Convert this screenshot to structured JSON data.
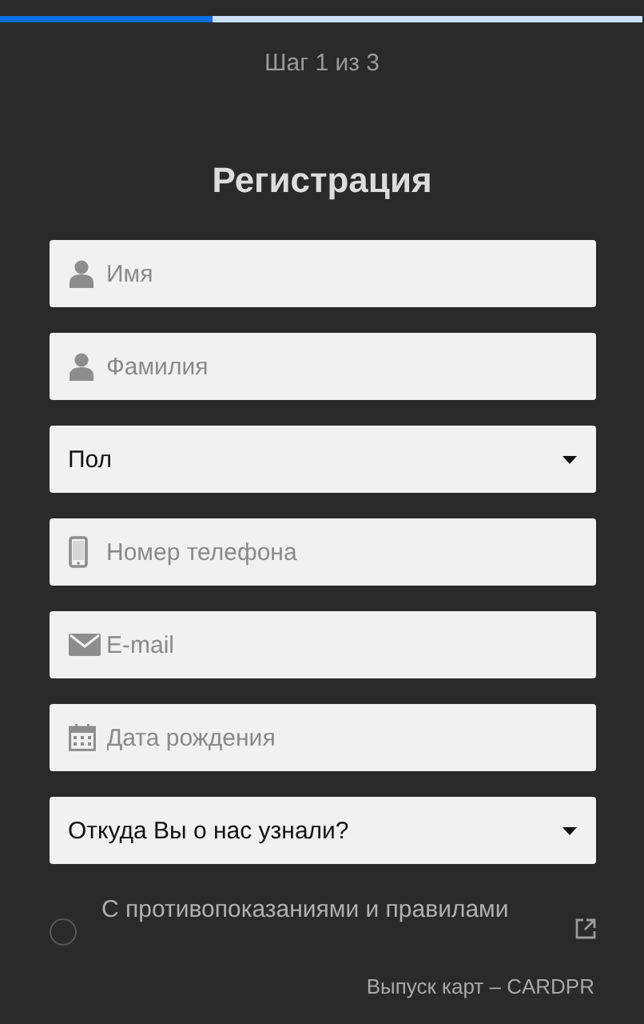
{
  "progress": {
    "level": 0.33
  },
  "step": "Шаг 1 из 3",
  "title": "Регистрация",
  "fields": [
    {
      "kind": "person",
      "placeholder": "Имя"
    },
    {
      "kind": "person",
      "placeholder": "Фамилия"
    },
    {
      "kind": "select",
      "value": "Пол"
    },
    {
      "kind": "phone",
      "placeholder": "Номер телефона"
    },
    {
      "kind": "mail",
      "placeholder": "E-mail"
    },
    {
      "kind": "calendar",
      "placeholder": "Дата рождения"
    },
    {
      "kind": "select",
      "value": "Откуда Вы о нас узнали?"
    }
  ],
  "agreement": {
    "checked": false,
    "text": "С противопоказаниями и правилами"
  },
  "footer": "Выпуск карт – CARDPR"
}
